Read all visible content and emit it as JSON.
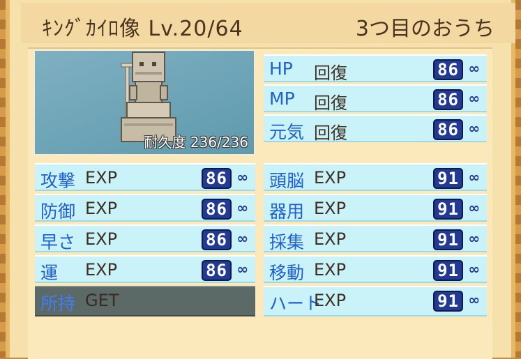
{
  "header": {
    "name_level": "ｷﾝｸﾞｶｲﾛ像 Lv.20/64",
    "location": "3つ目のおうち"
  },
  "portrait": {
    "durability_label": "耐久度",
    "durability_value": "236/236"
  },
  "recovery": [
    {
      "category": "HP",
      "stat": "回復",
      "value": "86",
      "icon": "infinity-icon"
    },
    {
      "category": "MP",
      "stat": "回復",
      "value": "86",
      "icon": "infinity-icon"
    },
    {
      "category": "元気",
      "stat": "回復",
      "value": "86",
      "icon": "infinity-icon"
    }
  ],
  "combat": [
    {
      "category": "攻撃",
      "stat": "EXP",
      "value": "86",
      "icon": "infinity-icon"
    },
    {
      "category": "防御",
      "stat": "EXP",
      "value": "86",
      "icon": "infinity-icon"
    },
    {
      "category": "早さ",
      "stat": "EXP",
      "value": "86",
      "icon": "infinity-icon"
    },
    {
      "category": "運",
      "stat": "EXP",
      "value": "86",
      "icon": "infinity-icon"
    },
    {
      "category": "所持",
      "stat": "GET",
      "value": "",
      "icon": ""
    }
  ],
  "skills": [
    {
      "category": "頭脳",
      "stat": "EXP",
      "value": "91",
      "icon": "infinity-icon"
    },
    {
      "category": "器用",
      "stat": "EXP",
      "value": "91",
      "icon": "infinity-icon"
    },
    {
      "category": "採集",
      "stat": "EXP",
      "value": "91",
      "icon": "infinity-icon"
    },
    {
      "category": "移動",
      "stat": "EXP",
      "value": "91",
      "icon": "infinity-icon"
    },
    {
      "category": "ハート",
      "stat": "EXP",
      "value": "91",
      "icon": "infinity-icon"
    }
  ],
  "colors": {
    "row_bg": "#c9f3f8",
    "category_text": "#1f5fd0",
    "value_badge": "#233a95",
    "panel_bg": "#fbe9bb"
  }
}
